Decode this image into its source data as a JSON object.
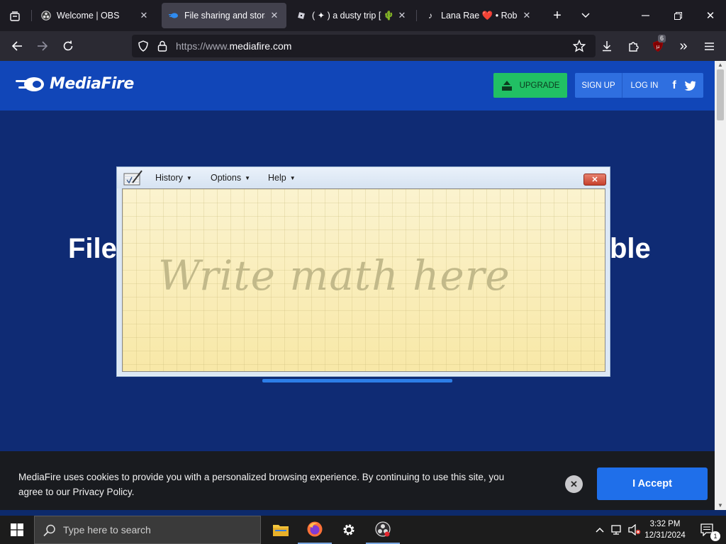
{
  "browser": {
    "tabs": [
      {
        "title": "Welcome | OBS",
        "active": false
      },
      {
        "title": "File sharing and storag",
        "active": true
      },
      {
        "title": "( ✦ ) a dusty trip [ 🌵 XM",
        "active": false
      },
      {
        "title": "Lana Rae ❤️ • Roblox",
        "active": false
      }
    ],
    "url_scheme": "https://www.",
    "url_host": "mediafire.com",
    "extension_badge": "6"
  },
  "site": {
    "logo_text": "MediaFire",
    "upgrade_label": "UPGRADE",
    "signup_label": "SIGN UP",
    "login_label": "LOG IN",
    "facebook_glyph": "f",
    "hero_left": "File",
    "hero_right": "ble",
    "brand_color": "#1146b8"
  },
  "math_panel": {
    "menus": [
      {
        "label": "History"
      },
      {
        "label": "Options"
      },
      {
        "label": "Help"
      }
    ],
    "close_glyph": "✕",
    "hint": "Write math here"
  },
  "cookie": {
    "text": "MediaFire uses cookies to provide you with a personalized browsing experience. By continuing to use this site, you agree to our Privacy Policy.",
    "close_glyph": "✕",
    "accept_label": "I Accept"
  },
  "taskbar": {
    "search_placeholder": "Type here to search",
    "time": "3:32 PM",
    "date": "12/31/2024",
    "notification_count": "1"
  }
}
